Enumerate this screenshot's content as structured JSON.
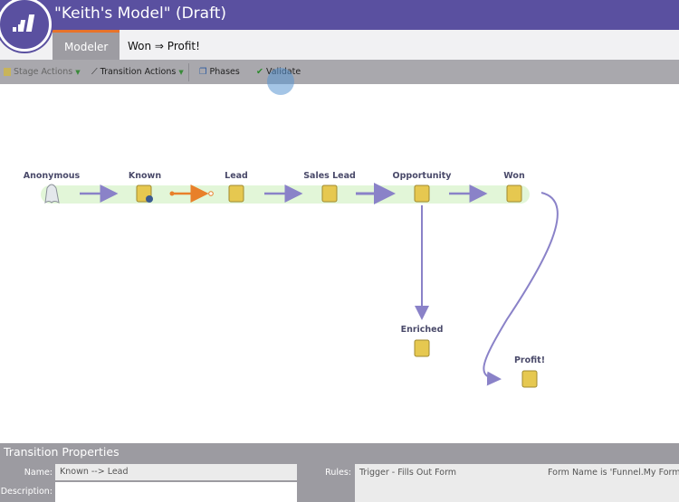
{
  "header": {
    "title": "\"Keith's Model\" (Draft)",
    "brand_color": "#5a50a0"
  },
  "tabs": [
    {
      "label": "Modeler",
      "active": true
    },
    {
      "label": "Won ⇒ Profit!",
      "active": false
    }
  ],
  "toolbar": {
    "stage_actions": "Stage Actions",
    "transition_actions": "Transition Actions",
    "phases": "Phases",
    "validate": "Validate"
  },
  "stages": [
    {
      "label": "Anonymous",
      "icon": "ghost-icon"
    },
    {
      "label": "Known",
      "icon": "box-person-icon"
    },
    {
      "label": "Lead",
      "icon": "box-icon"
    },
    {
      "label": "Sales Lead",
      "icon": "box-icon"
    },
    {
      "label": "Opportunity",
      "icon": "box-icon"
    },
    {
      "label": "Won",
      "icon": "box-icon"
    },
    {
      "label": "Enriched",
      "icon": "box-icon"
    },
    {
      "label": "Profit!",
      "icon": "box-icon"
    }
  ],
  "panel": {
    "title": "Transition Properties",
    "name_label": "Name:",
    "name_value": "Known --> Lead",
    "description_label": "Description:",
    "description_value": "",
    "rules_label": "Rules:",
    "rule_trigger": "Trigger - Fills Out Form",
    "rule_constraint": "Form Name is 'Funnel.My Form'"
  }
}
